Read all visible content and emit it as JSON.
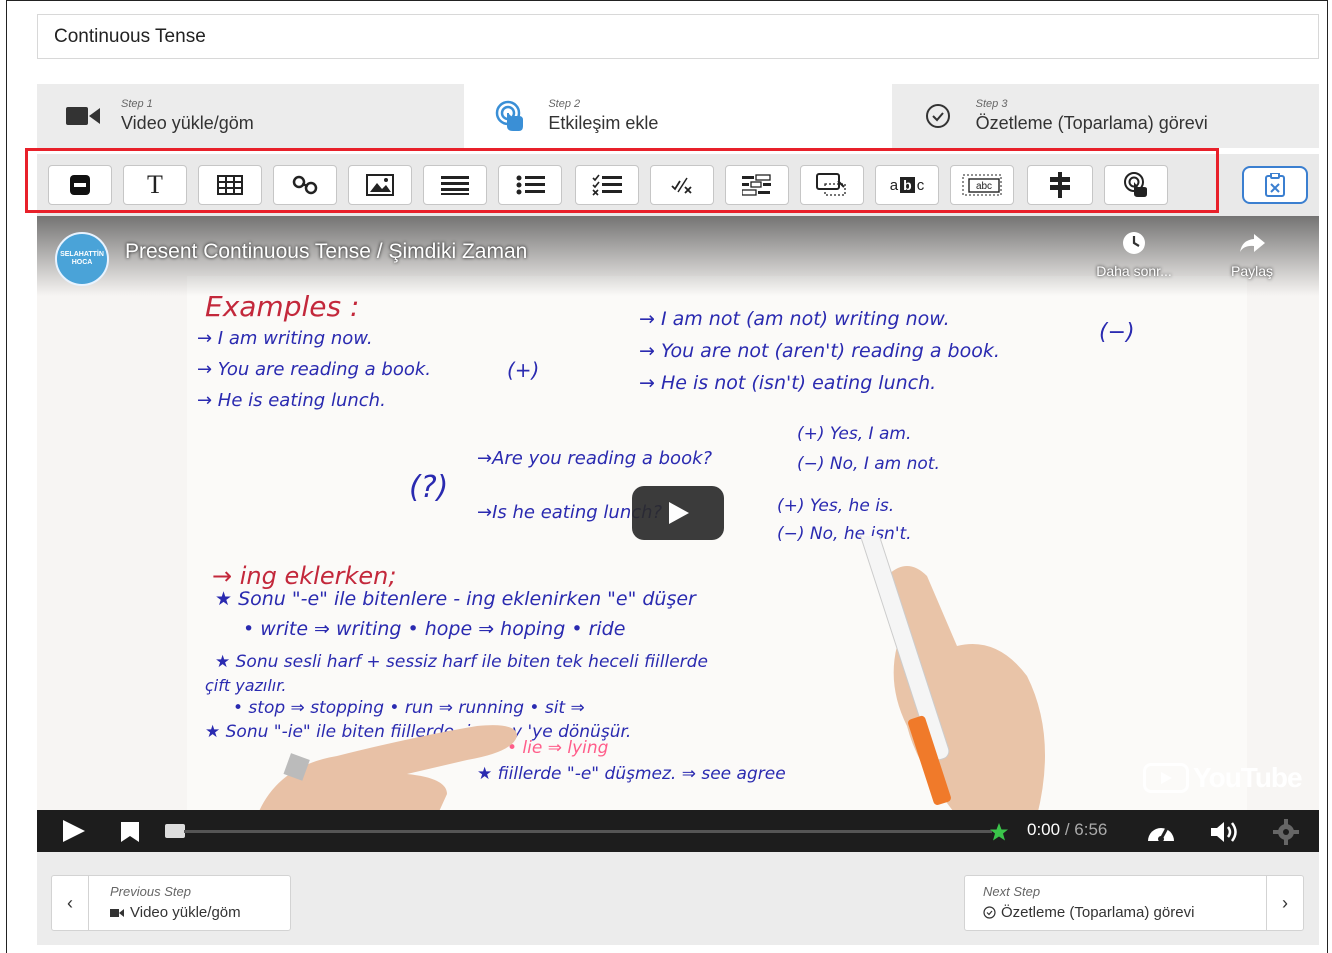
{
  "title_input": {
    "value": "Continuous Tense"
  },
  "steps": [
    {
      "step": "Step 1",
      "label": "Video yükle/göm",
      "icon": "video-camera-icon"
    },
    {
      "step": "Step 2",
      "label": "Etkileşim ekle",
      "icon": "touch-icon"
    },
    {
      "step": "Step 3",
      "label": "Özetleme (Toparlama) görevi",
      "icon": "check-circle-icon"
    }
  ],
  "toolbar": {
    "buttons": [
      "label-icon",
      "text-icon",
      "table-icon",
      "link-icon",
      "image-icon",
      "statements-icon",
      "single-choice-icon",
      "multiple-choice-icon",
      "true-false-icon",
      "fill-blanks-icon",
      "drag-drop-icon",
      "mark-words-icon",
      "drag-text-icon",
      "crossroads-icon",
      "navigation-hotspot-icon"
    ],
    "highlight_color": "#e8202a"
  },
  "video": {
    "title": "Present Continuous Tense / Şimdiki Zaman",
    "channel_logo_text": "SELAHATTİN HOCA",
    "watch_later": "Daha sonr...",
    "share": "Paylaş",
    "brand": "YouTube",
    "time_current": "0:00",
    "time_separator": " / ",
    "time_total": "6:56",
    "board": {
      "examples": "Examples :",
      "pos1": "→ I am writing now.",
      "pos2": "→ You are reading a book.",
      "pos3": "→ He is eating lunch.",
      "pos_sign": "(+)",
      "neg1": "→ I am not (am not) writing now.",
      "neg2": "→ You are not (aren't) reading a book.",
      "neg3": "→ He is not (isn't) eating lunch.",
      "neg_sign": "(−)",
      "q_sign": "(?)",
      "q1": "→Are you reading a book?",
      "q2": "→Is he eating lunch?",
      "a1": "(+) Yes, I am.",
      "a2": "(−) No, I am not.",
      "a3": "(+) Yes, he is.",
      "a4": "(−) No, he isn't.",
      "ing_head": "→ ing eklerken;",
      "r1": "★ Sonu \"-e\" ile bitenlere - ing eklenirken \"e\" düşer",
      "r1a": "• write ⇒ writing    • hope ⇒ hoping    • ride",
      "r2": "★ Sonu sesli harf + sessiz harf ile biten tek heceli fiillerde",
      "r2b": "çift yazılır.",
      "r2a": "• stop ⇒ stopping    • run ⇒ running    • sit ⇒",
      "r3": "★ Sonu \"-ie\" ile biten fiillerde -ie ⇒ -y 'ye dönüşür.",
      "r3a": "• lie ⇒ lying",
      "r4": "★ fiillerde \"-e\" düşmez. ⇒ see agree"
    }
  },
  "footer": {
    "prev_label": "Previous Step",
    "prev_value": "Video yükle/göm",
    "next_label": "Next Step",
    "next_value": "Özetleme (Toparlama) görevi"
  }
}
